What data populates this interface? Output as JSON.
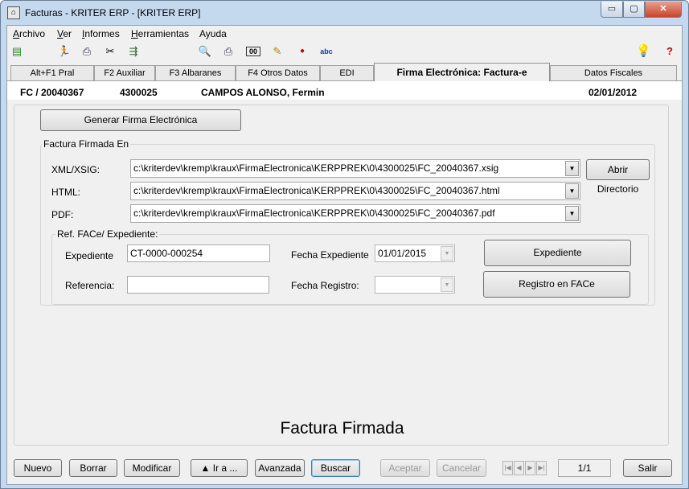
{
  "window": {
    "title": "Facturas - KRITER ERP - [KRITER ERP]",
    "min_glyph": "▭",
    "max_glyph": "▢",
    "close_glyph": "✕"
  },
  "menu": [
    {
      "label": "Archivo",
      "key": "A",
      "rest": "rchivo"
    },
    {
      "label": "Ver",
      "key": "V",
      "rest": "er"
    },
    {
      "label": "Informes",
      "key": "I",
      "rest": "nformes"
    },
    {
      "label": "Herramientas",
      "key": "H",
      "rest": "erramientas"
    },
    {
      "label": "Ayuda",
      "key": "",
      "rest": "Ayuda"
    }
  ],
  "toolbar": {
    "icons": [
      "books-icon",
      "runner-icon",
      "printer-icon",
      "scissors-icon",
      "export-icon",
      "print-preview-icon",
      "print-icon",
      "counter-icon",
      "notepad-icon",
      "record-icon",
      "spellcheck-icon",
      "lightbulb-icon",
      "help-icon"
    ],
    "counter_text": "00",
    "spell_text": "abc"
  },
  "tabs": [
    {
      "label": "Alt+F1 Pral",
      "active": false
    },
    {
      "label": "F2 Auxiliar",
      "active": false
    },
    {
      "label": "F3 Albaranes",
      "active": false
    },
    {
      "label": "F4 Otros Datos",
      "active": false
    },
    {
      "label": "EDI",
      "active": false
    },
    {
      "label": "Firma Electrónica: Factura-e",
      "active": true
    },
    {
      "label": "Datos Fiscales",
      "active": false
    }
  ],
  "invoice": {
    "number": "FC / 20040367",
    "account": "4300025",
    "customer": "CAMPOS ALONSO, Fermin",
    "date": "02/01/2012"
  },
  "panel": {
    "generate_button": "Generar Firma Electrónica",
    "signed_group_label": "Factura Firmada En",
    "xml_label": "XML/XSIG:",
    "xml_value": "c:\\kriterdev\\kremp\\kraux\\FirmaElectronica\\KERPPREK\\0\\4300025\\FC_20040367.xsig",
    "html_label": "HTML:",
    "html_value": "c:\\kriterdev\\kremp\\kraux\\FirmaElectronica\\KERPPREK\\0\\4300025\\FC_20040367.html",
    "pdf_label": "PDF:",
    "pdf_value": "c:\\kriterdev\\kremp\\kraux\\FirmaElectronica\\KERPPREK\\0\\4300025\\FC_20040367.pdf",
    "open_dir_button": "Abrir Directorio",
    "face_group_label": "Ref. FACe/ Expediente:",
    "expediente_label": "Expediente",
    "expediente_value": "CT-0000-000254",
    "fecha_expediente_label": "Fecha Expediente",
    "fecha_expediente_value": "01/01/2015",
    "expediente_button": "Expediente",
    "referencia_label": "Referencia:",
    "referencia_value": "",
    "fecha_registro_label": "Fecha Registro:",
    "fecha_registro_value": "",
    "registro_button": "Registro en FACe",
    "caption": "Factura Firmada"
  },
  "bottom": {
    "nuevo": "Nuevo",
    "borrar": "Borrar",
    "modificar": "Modificar",
    "ira": "▲ Ir a ...",
    "avanzada": "Avanzada",
    "buscar": "Buscar",
    "aceptar": "Aceptar",
    "cancelar": "Cancelar",
    "page": "1/1",
    "salir": "Salir"
  }
}
